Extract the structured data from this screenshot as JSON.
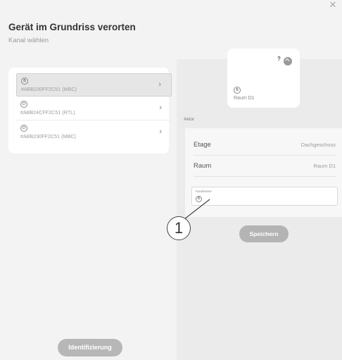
{
  "dialog": {
    "title": "Gerät im Grundriss verorten",
    "subtitle": "Kanal wählen",
    "close_icon": "close-icon"
  },
  "channel_list": {
    "items": [
      {
        "badge": "B",
        "label": "#ABB230FF2C51 (MBC)",
        "selected": true
      },
      {
        "badge": "D",
        "label": "#ABB24CFF2C51 (RTL)",
        "selected": false
      },
      {
        "badge": "D",
        "label": "#ABB230FF2C51 (MBC)",
        "selected": false
      }
    ],
    "chevron_icon": "chevron-right-icon"
  },
  "identify_button": {
    "label": "Identifizierung"
  },
  "preview": {
    "badge": "B",
    "room": "Raum D1",
    "status_icon": "check-circle-icon",
    "question_mark": "?"
  },
  "aktor": {
    "section_label": "Aktor",
    "fields": [
      {
        "label": "Etage",
        "value": "Dachgeschoss"
      },
      {
        "label": "Raum",
        "value": "Raum D1"
      }
    ],
    "channel_input": {
      "label": "Kanalname",
      "badge": "B"
    }
  },
  "save_button": {
    "label": "Speichern"
  },
  "callout": {
    "number": "1"
  },
  "colors": {
    "background": "#f3f3f3",
    "button_gray": "#b7b7b7",
    "selected_item": "#e6e6e6"
  }
}
